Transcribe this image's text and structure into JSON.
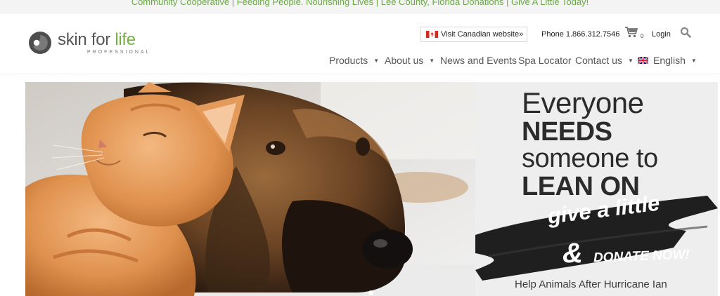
{
  "topbar": {
    "ticker_text": "Community Cooperative | Feeding People. Nourishing Lives | Lee County, Florida Donations | Give A Little Today!"
  },
  "logo": {
    "brand_main": "skin for ",
    "brand_accent": "life",
    "brand_sub": "PROFESSIONAL",
    "icon": "skin-for-life-logo-mark",
    "colors": {
      "gray": "#555555",
      "green": "#76b043"
    }
  },
  "utility": {
    "canada_label": "Visit Canadian website»",
    "phone": "Phone 1.866.312.7546",
    "cart_count": "0",
    "login": "Login",
    "icons": [
      "canada-flag-icon",
      "cart-icon",
      "search-icon"
    ]
  },
  "nav": {
    "items": [
      {
        "label": "Products",
        "has_dropdown": true
      },
      {
        "label": "About us",
        "has_dropdown": true
      },
      {
        "label": "News and Events",
        "has_dropdown": false
      },
      {
        "label": "Spa Locator",
        "has_dropdown": false
      },
      {
        "label": "Contact us",
        "has_dropdown": true
      },
      {
        "label": "English",
        "has_dropdown": true
      }
    ]
  },
  "banner": {
    "line1": "Everyone",
    "line2": "NEEDS",
    "line3": "someone to",
    "line4": "LEAN ON",
    "give": "give a little",
    "amp": "&",
    "donate": "DONATE NOW!",
    "help": "Help Animals After Hurricane Ian",
    "colors": {
      "panel": "#eeeeee",
      "text": "#2b2b2b",
      "brush": "#1f1f1f"
    }
  },
  "theme": {
    "accent_green": "#6aa845"
  }
}
